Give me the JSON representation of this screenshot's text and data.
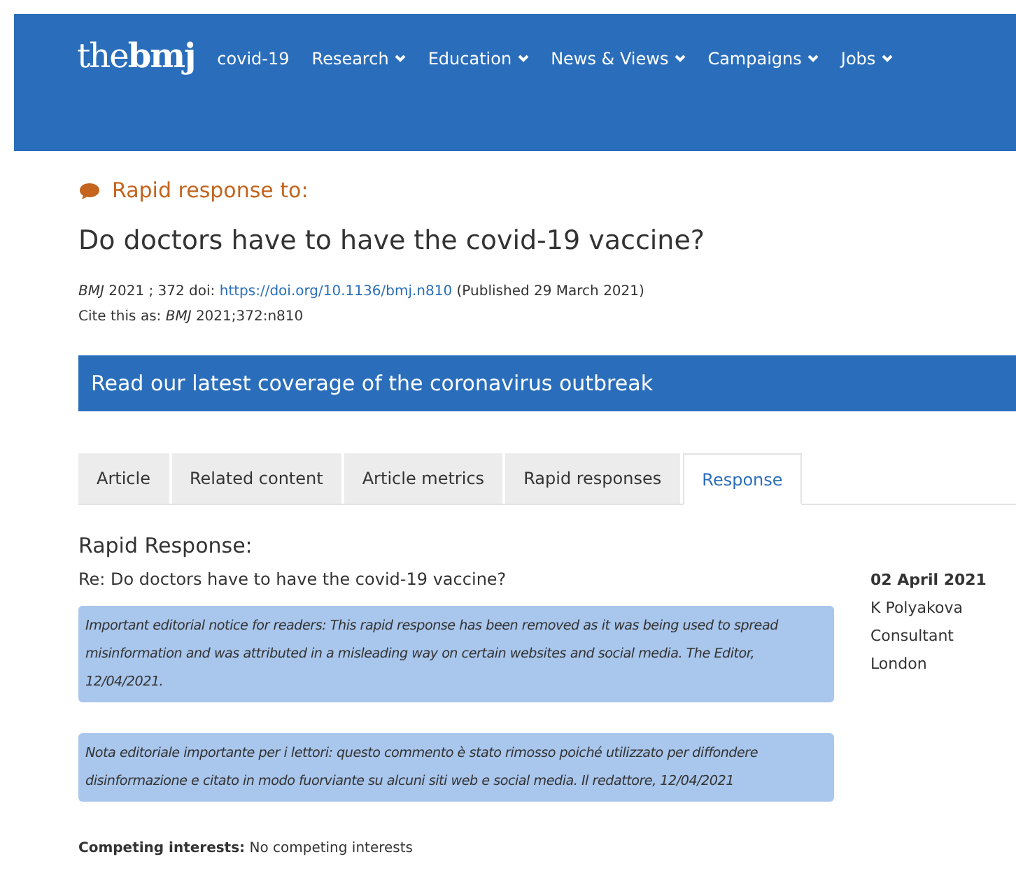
{
  "header": {
    "logo": {
      "light": "the",
      "bold": "bmj"
    },
    "nav": [
      {
        "label": "covid-19",
        "has_menu": false
      },
      {
        "label": "Research",
        "has_menu": true
      },
      {
        "label": "Education",
        "has_menu": true
      },
      {
        "label": "News & Views",
        "has_menu": true
      },
      {
        "label": "Campaigns",
        "has_menu": true
      },
      {
        "label": "Jobs",
        "has_menu": true
      }
    ]
  },
  "kicker": "Rapid response to:",
  "article_title": "Do doctors have to have the covid-19 vaccine?",
  "citation": {
    "before": "*BMJ*  2021 ; 372  doi:",
    "link": "https://doi.org/10.1136/bmj.n810",
    "after": "(Published 29 March 2021)"
  },
  "cite_as": "Cite this as: *BMJ*  2021;372:n810",
  "banner": "Read our latest coverage of the coronavirus outbreak",
  "tabs": [
    {
      "label": "Article",
      "selected": false
    },
    {
      "label": "Related content",
      "selected": false
    },
    {
      "label": "Article metrics",
      "selected": false
    },
    {
      "label": "Rapid responses",
      "selected": false
    },
    {
      "label": "Response",
      "selected": true
    }
  ],
  "response": {
    "heading": "Rapid Response:",
    "title": "Re: Do doctors have to have the covid-19 vaccine?",
    "notices": [
      "Important editorial notice for readers: This rapid response has been removed as it was being used to spread misinformation and was attributed in a misleading way on certain websites and social media. The Editor, 12/04/2021.",
      "Nota editoriale importante per i lettori: questo commento è stato rimosso poiché utilizzato per diffondere disinformazione e citato in modo fuorviante su alcuni siti web e social media. Il redattore, 12/04/2021"
    ],
    "competing_interests": "**Competing interests:** No competing interests"
  },
  "author": {
    "date": "02 April 2021",
    "name": "K Polyakova",
    "role": "Consultant",
    "place": "London"
  }
}
